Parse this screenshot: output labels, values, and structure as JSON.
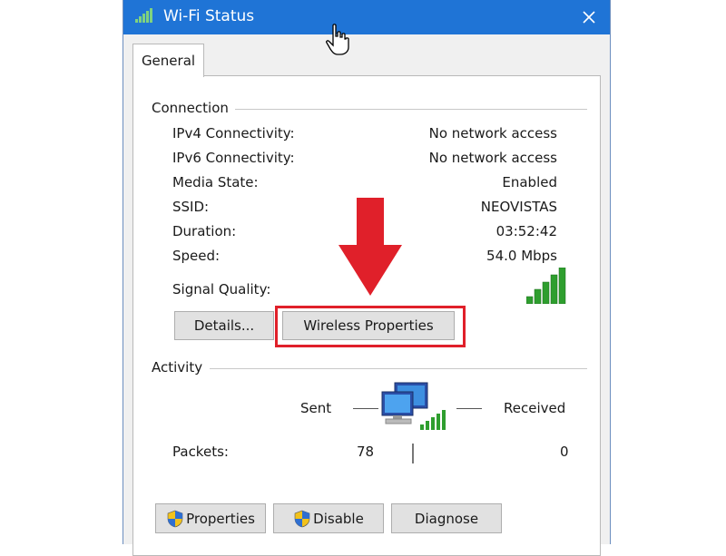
{
  "window": {
    "title": "Wi-Fi Status",
    "close_glyph": "✕"
  },
  "tabs": [
    {
      "label": "General",
      "active": true
    }
  ],
  "connection": {
    "group_title": "Connection",
    "rows": [
      {
        "label": "IPv4 Connectivity:",
        "value": "No network access"
      },
      {
        "label": "IPv6 Connectivity:",
        "value": "No network access"
      },
      {
        "label": "Media State:",
        "value": "Enabled"
      },
      {
        "label": "SSID:",
        "value": "NEOVISTAS"
      },
      {
        "label": "Duration:",
        "value": "03:52:42"
      },
      {
        "label": "Speed:",
        "value": "54.0 Mbps"
      }
    ],
    "signal_quality_label": "Signal Quality:",
    "signal_bars_lit": 5,
    "signal_bars_total": 5
  },
  "buttons_mid": {
    "details_label": "Details...",
    "wireless_properties_label": "Wireless Properties"
  },
  "activity": {
    "group_title": "Activity",
    "sent_label": "Sent",
    "received_label": "Received",
    "packets_label": "Packets:",
    "packets_sent": "78",
    "packets_received": "0"
  },
  "buttons_bottom": {
    "properties_label": "Properties",
    "disable_label": "Disable",
    "diagnose_label": "Diagnose"
  },
  "colors": {
    "titlebar": "#1f74d6",
    "highlight": "#e0202a",
    "signal_green": "#2e9e2e"
  }
}
